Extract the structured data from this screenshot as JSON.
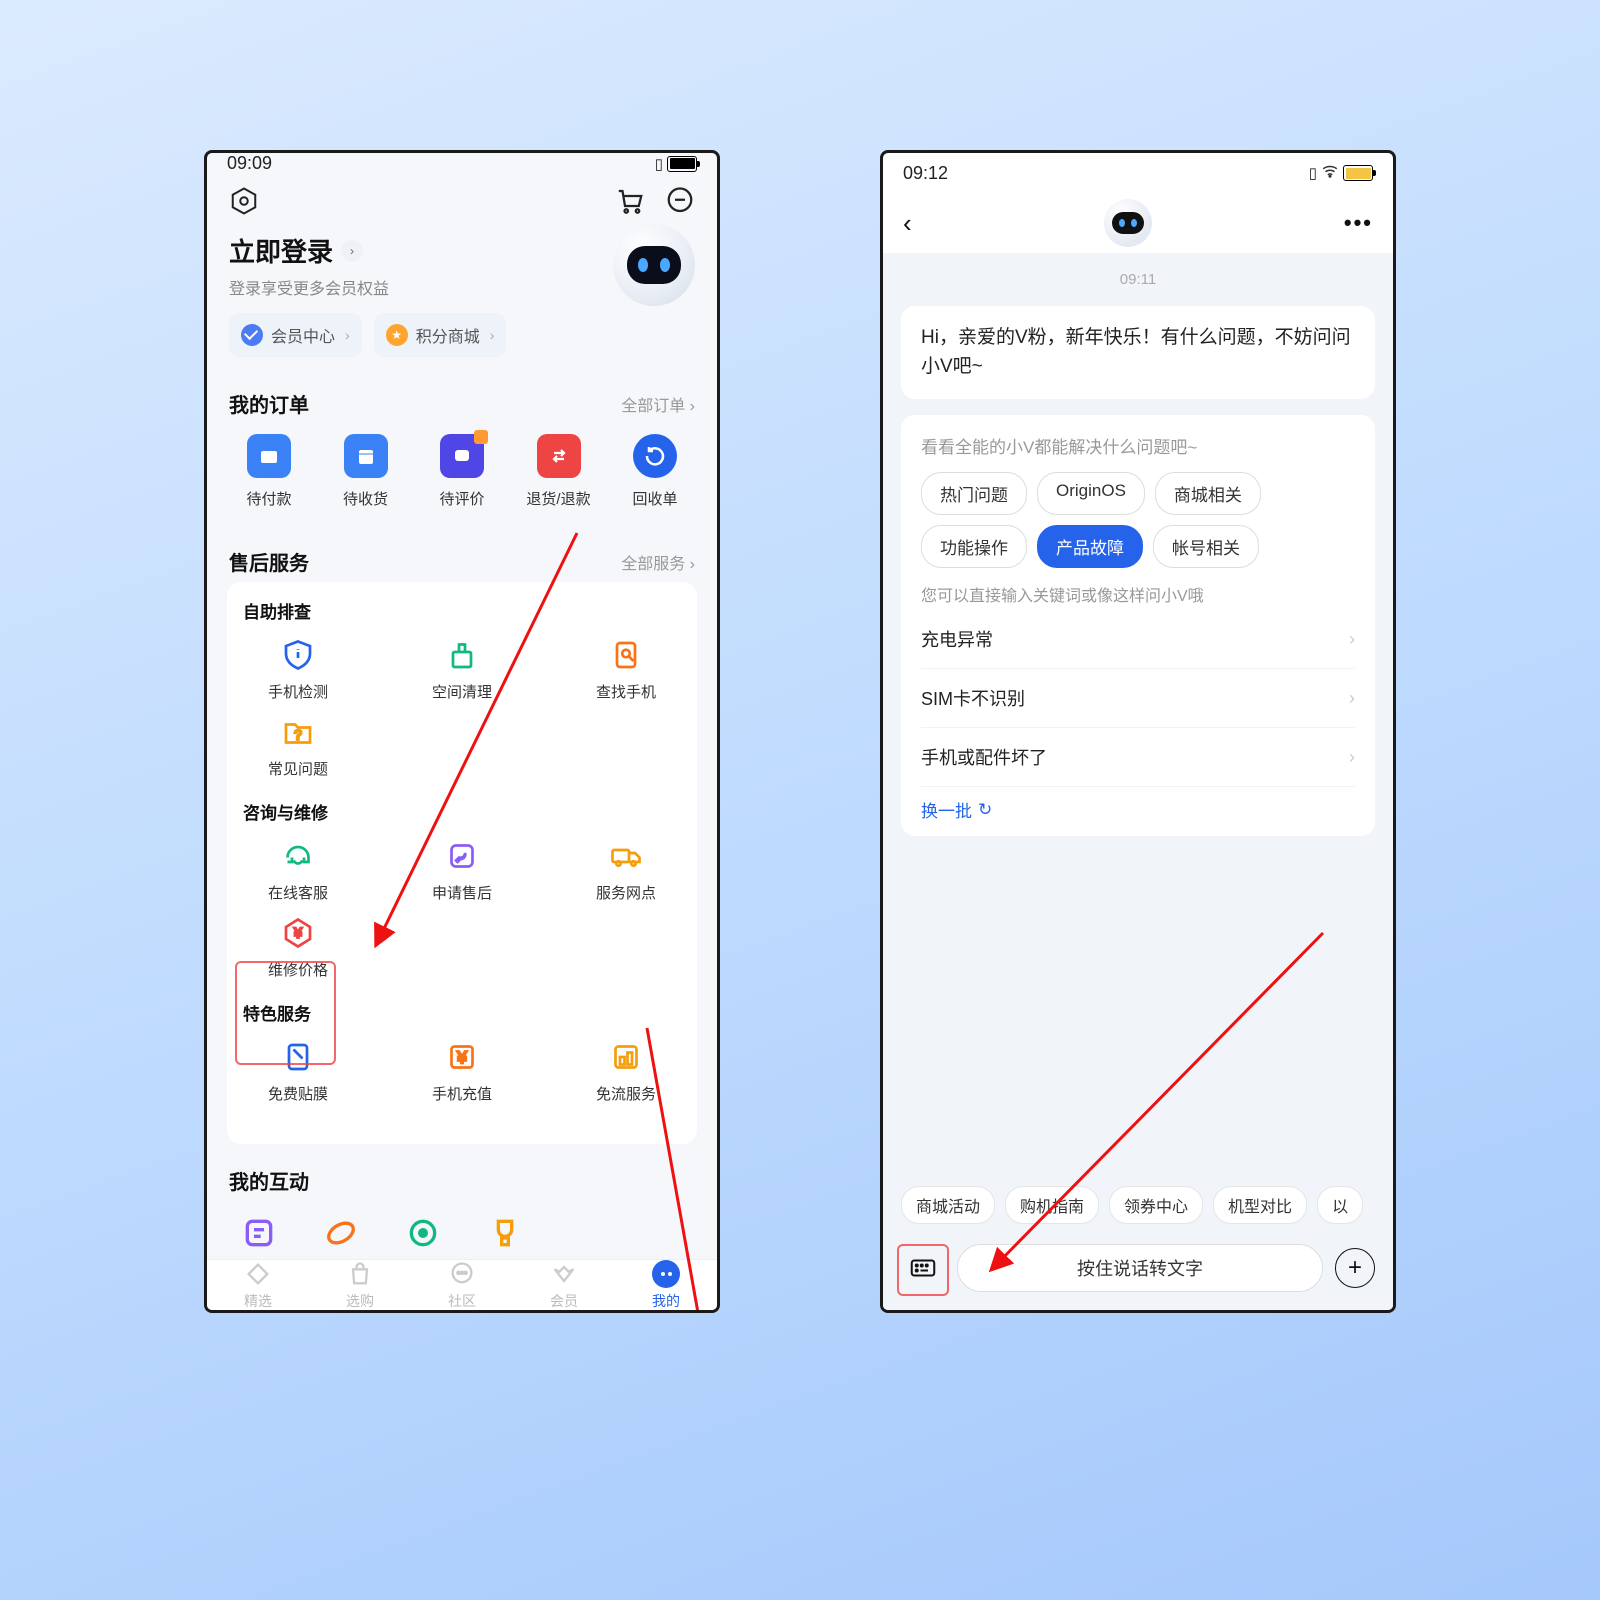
{
  "left": {
    "status": {
      "time": "09:09"
    },
    "login": {
      "title": "立即登录",
      "sub": "登录享受更多会员权益"
    },
    "pills": {
      "member": "会员中心",
      "points": "积分商城"
    },
    "orders": {
      "title": "我的订单",
      "more": "全部订单 ›",
      "items": [
        "待付款",
        "待收货",
        "待评价",
        "退货/退款",
        "回收单"
      ]
    },
    "service": {
      "title": "售后服务",
      "more": "全部服务 ›",
      "g1": {
        "t": "自助排查",
        "items": [
          "手机检测",
          "空间清理",
          "查找手机",
          "常见问题"
        ]
      },
      "g2": {
        "t": "咨询与维修",
        "items": [
          "在线客服",
          "申请售后",
          "服务网点",
          "维修价格"
        ]
      },
      "g3": {
        "t": "特色服务",
        "items": [
          "免费贴膜",
          "手机充值",
          "免流服务"
        ]
      }
    },
    "interact": {
      "title": "我的互动"
    },
    "nav": [
      "精选",
      "选购",
      "社区",
      "会员",
      "我的"
    ]
  },
  "right": {
    "status": {
      "time": "09:12"
    },
    "ts": "09:11",
    "greet": "Hi，亲爱的V粉，新年快乐！有什么问题，不妨问问小V吧~",
    "card": {
      "hint": "看看全能的小V都能解决什么问题吧~",
      "chips": [
        "热门问题",
        "OriginOS",
        "商城相关",
        "功能操作",
        "产品故障",
        "帐号相关"
      ],
      "active": 4,
      "hint2": "您可以直接输入关键词或像这样问小V哦",
      "qs": [
        "充电异常",
        "SIM卡不识别",
        "手机或配件坏了"
      ],
      "refresh": "换一批"
    },
    "sugs": [
      "商城活动",
      "购机指南",
      "领券中心",
      "机型对比",
      "以"
    ],
    "voice": "按住说话转文字"
  }
}
